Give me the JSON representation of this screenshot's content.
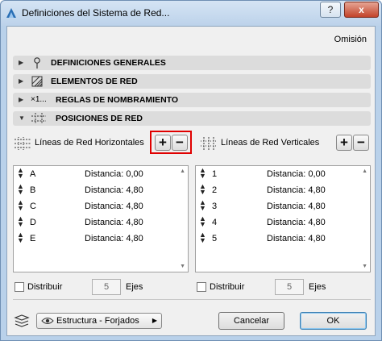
{
  "window": {
    "title": "Definiciones del Sistema de Red...",
    "help_label": "?",
    "close_label": "x"
  },
  "omision_label": "Omisión",
  "sections": [
    {
      "label": "DEFINICIONES GENERALES",
      "expanded": false,
      "icon": "pin-icon"
    },
    {
      "label": "ELEMENTOS DE RED",
      "expanded": false,
      "icon": "grid-element-icon"
    },
    {
      "label": "REGLAS DE NOMBRAMIENTO",
      "expanded": false,
      "icon": "naming-icon",
      "icon_text": "×1..."
    },
    {
      "label": "POSICIONES DE RED",
      "expanded": true,
      "icon": "grid-positions-icon"
    }
  ],
  "horizontal": {
    "header": "Líneas de Red Horizontales",
    "add_label": "+",
    "remove_label": "−",
    "rows": [
      {
        "name": "A",
        "distance": "Distancia: 0,00"
      },
      {
        "name": "B",
        "distance": "Distancia: 4,80"
      },
      {
        "name": "C",
        "distance": "Distancia: 4,80"
      },
      {
        "name": "D",
        "distance": "Distancia: 4,80"
      },
      {
        "name": "E",
        "distance": "Distancia: 4,80"
      }
    ],
    "distribute_label": "Distribuir",
    "distribute_checked": false,
    "axes_value": "5",
    "axes_label": "Ejes"
  },
  "vertical": {
    "header": "Líneas de Red Verticales",
    "add_label": "+",
    "remove_label": "−",
    "rows": [
      {
        "name": "1",
        "distance": "Distancia: 0,00"
      },
      {
        "name": "2",
        "distance": "Distancia: 4,80"
      },
      {
        "name": "3",
        "distance": "Distancia: 4,80"
      },
      {
        "name": "4",
        "distance": "Distancia: 4,80"
      },
      {
        "name": "5",
        "distance": "Distancia: 4,80"
      }
    ],
    "distribute_label": "Distribuir",
    "distribute_checked": false,
    "axes_value": "5",
    "axes_label": "Ejes"
  },
  "footer": {
    "layer_dropdown": "Estructura - Forjados",
    "cancel_label": "Cancelar",
    "ok_label": "OK"
  },
  "colors": {
    "highlight": "#e00000",
    "section_bg": "#dcdcdc",
    "dialog_bg": "#f0f0f0"
  }
}
